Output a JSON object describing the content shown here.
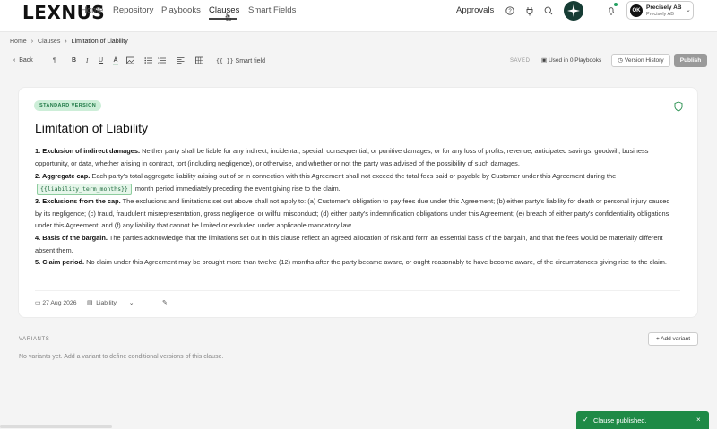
{
  "nav": {
    "logo": "LEXNUS",
    "links": [
      "Home",
      "Repository",
      "Playbooks",
      "Clauses",
      "Smart Fields"
    ],
    "active": "Clauses",
    "approvals": "Approvals",
    "icons": [
      "help-icon",
      "plug-icon",
      "search-icon",
      "sparkle-icon",
      "bell-icon"
    ],
    "org": {
      "initials": "OK",
      "name": "Precisely AB",
      "sub": "Precisely AB"
    }
  },
  "breadcrumb": [
    "Home",
    "Clauses",
    "Limitation of Liability"
  ],
  "toolbar": {
    "back": "Back",
    "smart_field": "Smart field",
    "saved": "SAVED",
    "used_in": "Used in 0 Playbooks",
    "version_history": "Version History",
    "publish": "Publish"
  },
  "clause": {
    "badge": "STANDARD VERSION",
    "title": "Limitation of Liability",
    "sections": [
      {
        "heading": "1. Exclusion of indirect damages.",
        "text": " Neither party shall be liable for any indirect, incidental, special, consequential, or punitive damages, or for any loss of profits, revenue, anticipated savings, goodwill, business opportunity, or data, whether arising in contract, tort (including negligence), or otherwise, and whether or not the party was advised of the possibility of such damages."
      },
      {
        "heading": "2. Aggregate cap.",
        "text": " Each party's total aggregate liability arising out of or in connection with this Agreement shall not exceed the total fees paid or payable by Customer under this Agreement during the",
        "smart_field": "{{liability_term_months}}",
        "text_after": " month period immediately preceding the event giving rise to the claim."
      },
      {
        "heading": "3. Exclusions from the cap.",
        "text": " The exclusions and limitations set out above shall not apply to: (a) Customer's obligation to pay fees due under this Agreement; (b) either party's liability for death or personal injury caused by its negligence; (c) fraud, fraudulent misrepresentation, gross negligence, or willful misconduct; (d) either party's indemnification obligations under this Agreement; (e) breach of either party's confidentiality obligations under this Agreement; and (f) any liability that cannot be limited or excluded under applicable mandatory law."
      },
      {
        "heading": "4. Basis of the bargain.",
        "text": " The parties acknowledge that the limitations set out in this clause reflect an agreed allocation of risk and form an essential basis of the bargain, and that the fees would be materially different absent them."
      },
      {
        "heading": "5. Claim period.",
        "text": " No claim under this Agreement may be brought more than twelve (12) months after the party became aware, or ought reasonably to have become aware, of the circumstances giving rise to the claim."
      }
    ],
    "date": "27 Aug 2026",
    "category": "Liability"
  },
  "variants": {
    "title": "VARIANTS",
    "add": "+ Add variant",
    "empty": "No variants yet. Add a variant to define conditional versions of this clause."
  },
  "toast": {
    "message": "Clause published.",
    "close": "×"
  },
  "colors": {
    "accent_green": "#1e8a46",
    "badge_bg": "#cdeed8",
    "ai_button": "#163c34"
  }
}
